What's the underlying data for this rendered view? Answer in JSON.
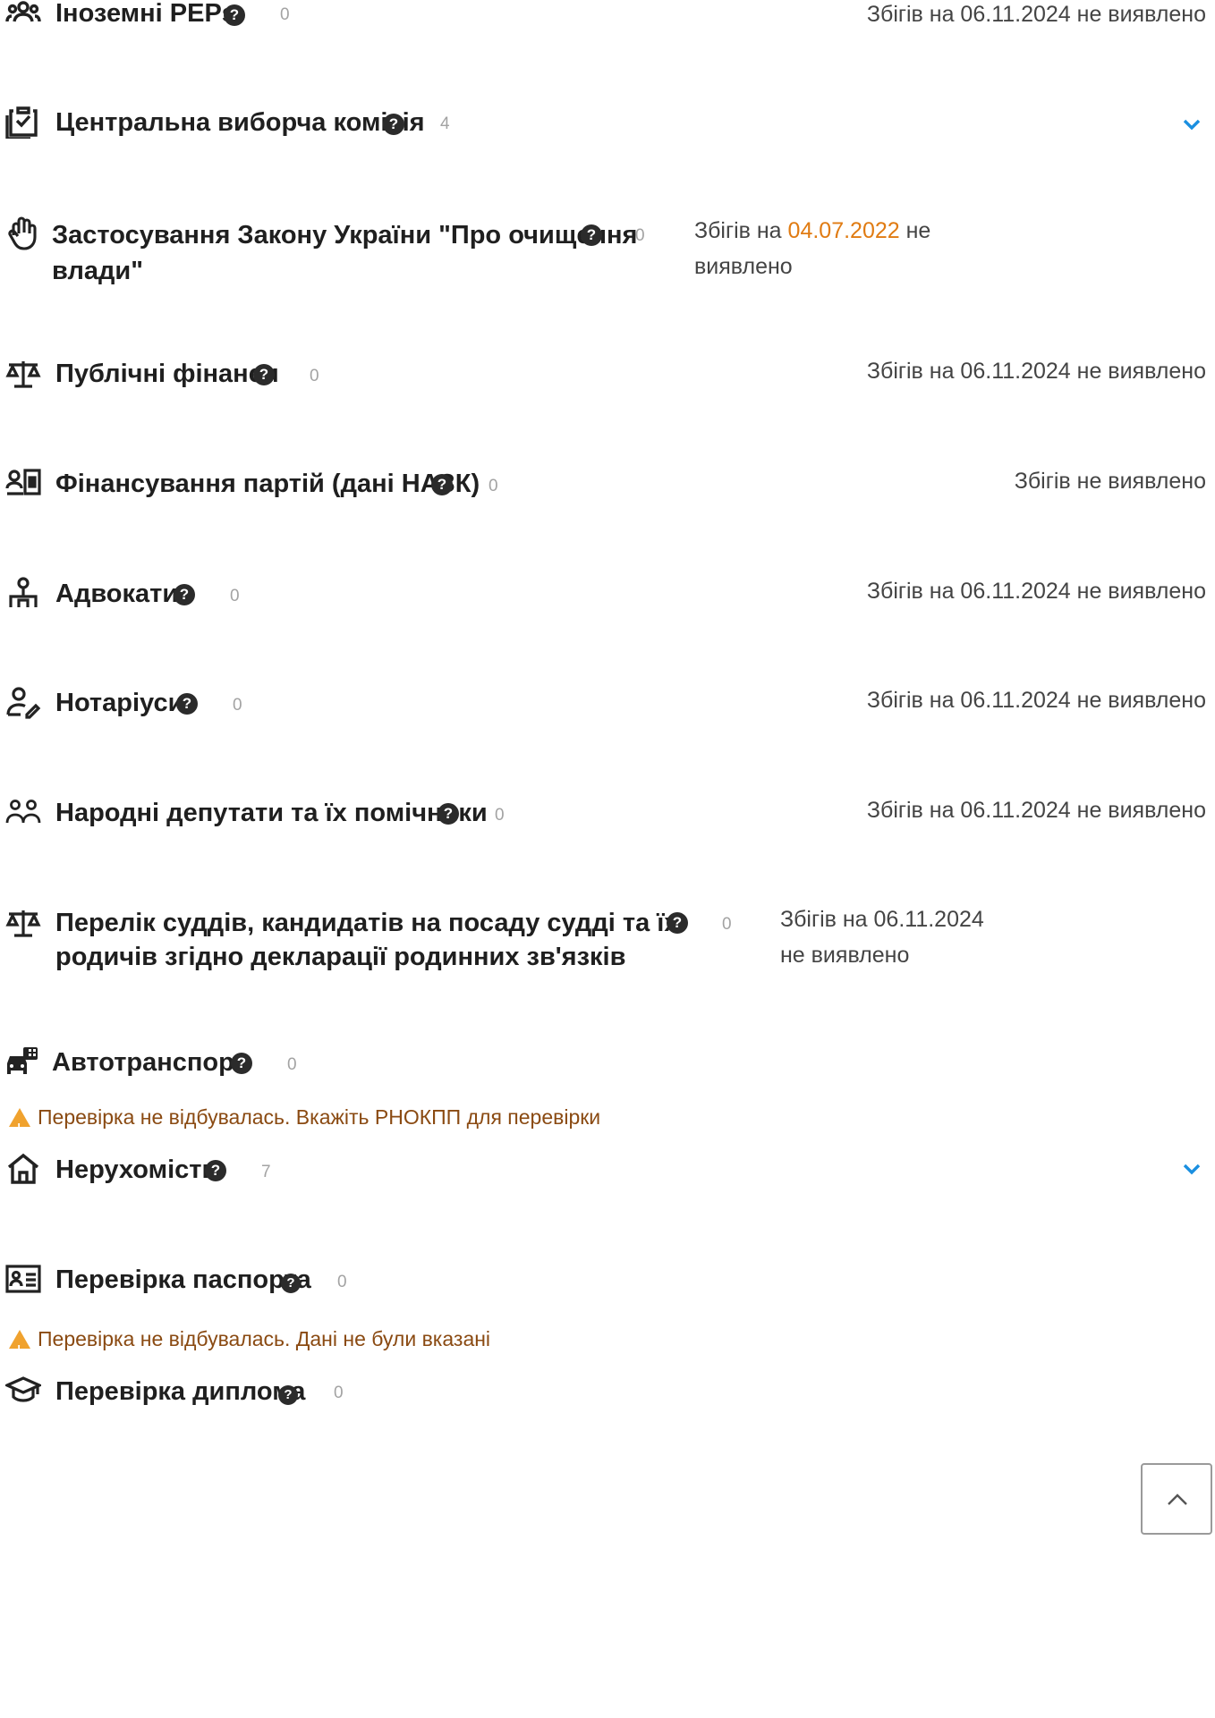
{
  "rows": [
    {
      "title": "Іноземні PEPs",
      "count": "0",
      "status": "Збігів на 06.11.2024 не виявлено",
      "icon": "people-group-icon"
    },
    {
      "title": "Центральна виборча комісія",
      "count": "4",
      "icon": "clipboard-check-icon"
    },
    {
      "title_line1": "Застосування Закону України \"Про очищення",
      "title_line2": "влади\"",
      "count": "0",
      "status_pre": "Збігів на",
      "status_date": "04.07.2022",
      "status_post1": "не",
      "status_post2": "виявлено",
      "icon": "hand-stop-icon"
    },
    {
      "title": "Публічні фінанси",
      "count": "0",
      "status": "Збігів на 06.11.2024 не виявлено",
      "icon": "scales-icon"
    },
    {
      "title": "Фінансування партій (дані НАЗК)",
      "count": "0",
      "status": "Збігів не виявлено",
      "icon": "party-funding-icon"
    },
    {
      "title": "Адвокати",
      "count": "0",
      "status": "Збігів на 06.11.2024 не виявлено",
      "icon": "lawyer-icon"
    },
    {
      "title": "Нотаріуси",
      "count": "0",
      "status": "Збігів на 06.11.2024 не виявлено",
      "icon": "notary-icon"
    },
    {
      "title": "Народні депутати та їх помічники",
      "count": "0",
      "status": "Збігів на 06.11.2024 не виявлено",
      "icon": "deputies-icon"
    },
    {
      "title_line1": "Перелік суддів, кандидатів на посаду судді та їх",
      "title_line2": "родичів згідно декларації родинних зв'язків",
      "count": "0",
      "status_line1": "Збігів на 06.11.2024",
      "status_line2": "не виявлено",
      "icon": "scales-icon"
    },
    {
      "title": "Автотранспорт",
      "count": "0",
      "warning": "Перевірка не відбувалась. Вкажіть РНОКПП для перевірки",
      "icon": "vehicles-icon"
    },
    {
      "title": "Нерухомість",
      "count": "7",
      "icon": "house-icon"
    },
    {
      "title": "Перевірка паспорта",
      "count": "0",
      "warning": "Перевірка не відбувалась. Дані не були вказані",
      "icon": "id-card-icon"
    },
    {
      "title": "Перевірка диплома",
      "count": "0",
      "icon": "graduation-cap-icon"
    }
  ],
  "help_glyph": "?",
  "colors": {
    "accent": "#1a8fe0",
    "date": "#e07b12",
    "warning_text": "#8a4a12",
    "warning_icon": "#f0a22e"
  }
}
